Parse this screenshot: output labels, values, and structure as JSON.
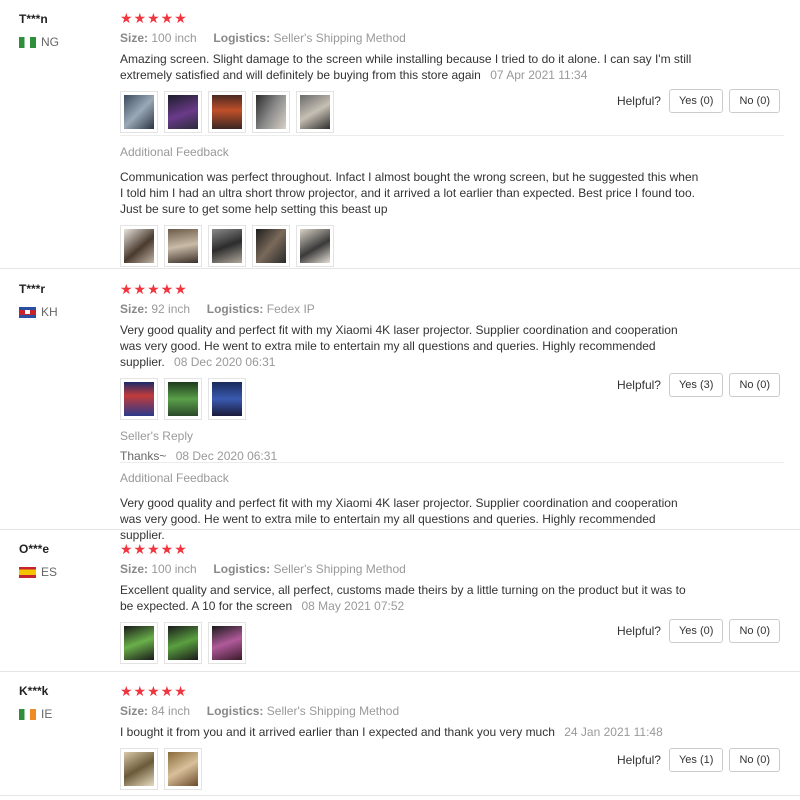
{
  "helpful_label": "Helpful?",
  "additional_feedback_title": "Additional Feedback",
  "seller_reply_title": "Seller's Reply",
  "stars": "★★★★★",
  "reviews": [
    {
      "user": "T***n",
      "country": "NG",
      "size_label": "Size:",
      "size": "100 inch",
      "logistics_label": "Logistics:",
      "logistics": "Seller's Shipping Method",
      "text": "Amazing screen. Slight damage to the screen while installing because I tried to do it alone. I can say I'm still extremely satisfied and will definitely be buying from this store again",
      "date": "07 Apr 2021 11:34",
      "yes": "Yes (0)",
      "no": "No (0)",
      "feedback_text": "Communication was perfect throughout. Infact I almost bought the wrong screen, but he suggested this when I told him I had an ultra short throw projector, and it arrived a lot earlier than expected. Best price I found too. Just be sure to get some help setting this beast up"
    },
    {
      "user": "T***r",
      "country": "KH",
      "size_label": "Size:",
      "size": "92 inch",
      "logistics_label": "Logistics:",
      "logistics": "Fedex IP",
      "text": "Very good quality and perfect fit with my Xiaomi 4K laser projector. Supplier coordination and cooperation was very good. He went to extra mile to entertain my all questions and queries. Highly recommended supplier.",
      "date": "08 Dec 2020 06:31",
      "yes": "Yes (3)",
      "no": "No (0)",
      "reply_text": "Thanks~",
      "reply_date": "08 Dec 2020 06:31",
      "feedback_text": "Very good quality and perfect fit with my Xiaomi 4K laser projector. Supplier coordination and cooperation was very good. He went to extra mile to entertain my all questions and queries. Highly recommended supplier."
    },
    {
      "user": "O***e",
      "country": "ES",
      "size_label": "Size:",
      "size": "100 inch",
      "logistics_label": "Logistics:",
      "logistics": "Seller's Shipping Method",
      "text": "Excellent quality and service, all perfect, customs made theirs by a little turning on the product but it was to be expected. A 10 for the screen",
      "date": "08 May 2021 07:52",
      "yes": "Yes (0)",
      "no": "No (0)"
    },
    {
      "user": "K***k",
      "country": "IE",
      "size_label": "Size:",
      "size": "84 inch",
      "logistics_label": "Logistics:",
      "logistics": "Seller's Shipping Method",
      "text": "I bought it from you and it arrived earlier than I expected and thank you very much",
      "date": "24 Jan 2021 11:48",
      "yes": "Yes (1)",
      "no": "No (0)"
    }
  ]
}
